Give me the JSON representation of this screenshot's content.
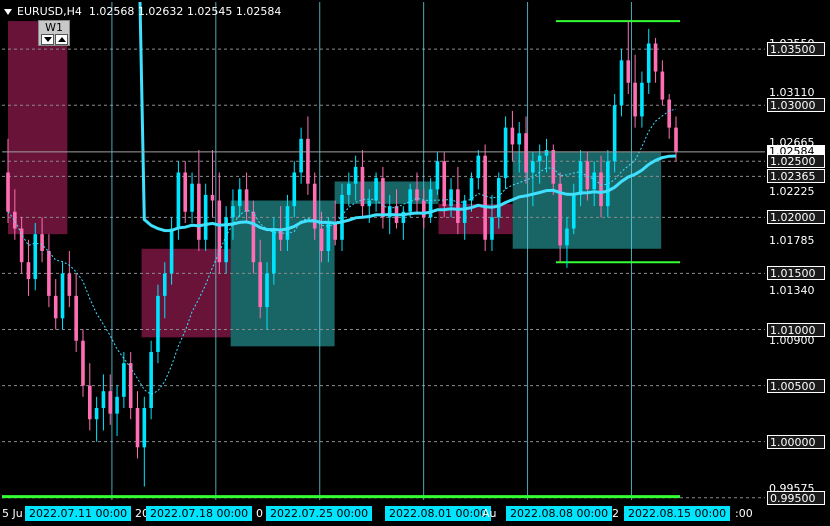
{
  "header": {
    "symbol_info": "EURUSD,H4",
    "ohlc": "1.02568 1.02632 1.02545 1.02584",
    "timeframe_button": "W1"
  },
  "colors": {
    "background": "#000000",
    "grid": "#8c8c8c",
    "bull_candle": "#00e5ff",
    "bear_candle": "#ff6eb4",
    "ma_slow": "#40e0ff",
    "ma_fast_dotted": "#40e0ff",
    "bear_zone": "#8b1a4a",
    "bull_zone": "#2aa7a7",
    "level_line": "#33ff33",
    "vertical_lines": "#5fd3e6"
  },
  "price_axis": {
    "labels": [
      {
        "text": "1.03550",
        "style": "grey",
        "price": 1.0355
      },
      {
        "text": "1.03500",
        "style": "boxed",
        "price": 1.035
      },
      {
        "text": "1.03110",
        "style": "grey",
        "price": 1.0311
      },
      {
        "text": "1.03000",
        "style": "boxed",
        "price": 1.03
      },
      {
        "text": "1.02665",
        "style": "grey",
        "price": 1.02665
      },
      {
        "text": "1.02584",
        "style": "current",
        "price": 1.02584
      },
      {
        "text": "1.02500",
        "style": "boxed",
        "price": 1.025
      },
      {
        "text": "1.02365",
        "style": "boxed",
        "price": 1.02365
      },
      {
        "text": "1.02225",
        "style": "grey",
        "price": 1.02225
      },
      {
        "text": "1.02000",
        "style": "boxed",
        "price": 1.02
      },
      {
        "text": "1.01785",
        "style": "grey",
        "price": 1.01785
      },
      {
        "text": "1.01500",
        "style": "boxed",
        "price": 1.015
      },
      {
        "text": "1.01340",
        "style": "grey",
        "price": 1.0134
      },
      {
        "text": "1.01000",
        "style": "boxed",
        "price": 1.01
      },
      {
        "text": "1.00900",
        "style": "grey",
        "price": 1.009
      },
      {
        "text": "1.00500",
        "style": "boxed",
        "price": 1.005
      },
      {
        "text": "1.00000",
        "style": "boxed",
        "price": 1.0
      },
      {
        "text": "0.99575",
        "style": "grey",
        "price": 0.99575
      },
      {
        "text": "0.99500",
        "style": "boxed",
        "price": 0.995
      }
    ]
  },
  "time_axis": {
    "labels": [
      {
        "text": "5 Ju",
        "style": "plain"
      },
      {
        "text": "2022.07.11 00:00",
        "style": "hl"
      },
      {
        "text": "20",
        "style": "plain"
      },
      {
        "text": "2022.07.18 00:00",
        "style": "hl"
      },
      {
        "text": "0",
        "style": "plain"
      },
      {
        "text": "2022.07.25 00:00",
        "style": "hl"
      },
      {
        "text": "2022.08.01 00:00",
        "style": "hl"
      },
      {
        "text": "Au",
        "style": "plain"
      },
      {
        "text": "2022.08.08 00:00",
        "style": "hl"
      },
      {
        "text": "2",
        "style": "plain"
      },
      {
        "text": "2022.08.15 00:00",
        "style": "hl"
      },
      {
        "text": ":00",
        "style": "plain"
      }
    ]
  },
  "chart_data": {
    "type": "candlestick",
    "symbol": "EURUSD",
    "timeframe": "H4",
    "ylim": [
      0.9948,
      1.0392
    ],
    "current_price": 1.02584,
    "horizontal_levels": [
      1.035,
      1.03,
      1.025,
      1.02365,
      1.02,
      1.015,
      1.01,
      1.005,
      1.0,
      0.995
    ],
    "green_levels": [
      1.0375,
      1.016,
      0.9951
    ],
    "zones": [
      {
        "kind": "bear",
        "from": "2022.07.04",
        "to": "2022.07.08",
        "high": 1.0375,
        "low": 1.0185
      },
      {
        "kind": "bear",
        "from": "2022.07.13",
        "to": "2022.07.19",
        "high": 1.0172,
        "low": 1.0093
      },
      {
        "kind": "bull",
        "from": "2022.07.19",
        "to": "2022.07.26",
        "high": 1.0215,
        "low": 1.0085
      },
      {
        "kind": "bull",
        "from": "2022.07.26",
        "to": "2022.08.02",
        "high": 1.0232,
        "low": 1.0212
      },
      {
        "kind": "bear",
        "from": "2022.08.02",
        "to": "2022.08.07",
        "high": 1.0212,
        "low": 1.0185
      },
      {
        "kind": "bull",
        "from": "2022.08.07",
        "to": "2022.08.17",
        "high": 1.0258,
        "low": 1.0172
      }
    ],
    "ohlc": [
      [
        1.024,
        1.027,
        1.0195,
        1.0205
      ],
      [
        1.0205,
        1.0225,
        1.018,
        1.019
      ],
      [
        1.019,
        1.02,
        1.015,
        1.016
      ],
      [
        1.016,
        1.018,
        1.013,
        1.0145
      ],
      [
        1.0145,
        1.0195,
        1.0135,
        1.0185
      ],
      [
        1.0185,
        1.02,
        1.016,
        1.017
      ],
      [
        1.017,
        1.0185,
        1.012,
        1.013
      ],
      [
        1.013,
        1.0145,
        1.01,
        1.011
      ],
      [
        1.011,
        1.016,
        1.01,
        1.015
      ],
      [
        1.015,
        1.017,
        1.012,
        1.013
      ],
      [
        1.013,
        1.015,
        1.008,
        1.009
      ],
      [
        1.009,
        1.01,
        1.004,
        1.005
      ],
      [
        1.005,
        1.007,
        1.001,
        1.002
      ],
      [
        1.002,
        1.004,
        1.0,
        1.003
      ],
      [
        1.003,
        1.006,
        1.001,
        1.0045
      ],
      [
        1.0045,
        1.006,
        1.0015,
        1.0025
      ],
      [
        1.0025,
        1.005,
        1.0005,
        1.004
      ],
      [
        1.004,
        1.008,
        1.003,
        1.007
      ],
      [
        1.007,
        1.008,
        1.002,
        1.003
      ],
      [
        1.003,
        1.0045,
        0.9985,
        0.9995
      ],
      [
        0.9995,
        1.004,
        0.996,
        1.003
      ],
      [
        1.003,
        1.009,
        1.002,
        1.008
      ],
      [
        1.008,
        1.014,
        1.007,
        1.013
      ],
      [
        1.013,
        1.016,
        1.011,
        1.015
      ],
      [
        1.015,
        1.02,
        1.014,
        1.019
      ],
      [
        1.019,
        1.025,
        1.018,
        1.024
      ],
      [
        1.024,
        1.025,
        1.0195,
        1.0205
      ],
      [
        1.0205,
        1.024,
        1.0195,
        1.023
      ],
      [
        1.023,
        1.026,
        1.017,
        1.018
      ],
      [
        1.018,
        1.023,
        1.017,
        1.022
      ],
      [
        1.022,
        1.026,
        1.02,
        1.0215
      ],
      [
        1.0215,
        1.024,
        1.015,
        1.016
      ],
      [
        1.016,
        1.021,
        1.015,
        1.02
      ],
      [
        1.02,
        1.0225,
        1.018,
        1.021
      ],
      [
        1.021,
        1.0235,
        1.02,
        1.0225
      ],
      [
        1.0225,
        1.024,
        1.0195,
        1.0205
      ],
      [
        1.0205,
        1.0215,
        1.015,
        1.016
      ],
      [
        1.016,
        1.018,
        1.011,
        1.012
      ],
      [
        1.012,
        1.016,
        1.01,
        1.015
      ],
      [
        1.015,
        1.02,
        1.014,
        1.019
      ],
      [
        1.019,
        1.021,
        1.017,
        1.018
      ],
      [
        1.018,
        1.022,
        1.017,
        1.021
      ],
      [
        1.021,
        1.025,
        1.02,
        1.024
      ],
      [
        1.024,
        1.028,
        1.023,
        1.027
      ],
      [
        1.027,
        1.029,
        1.022,
        1.023
      ],
      [
        1.023,
        1.024,
        1.018,
        1.019
      ],
      [
        1.019,
        1.0205,
        1.016,
        1.017
      ],
      [
        1.017,
        1.02,
        1.016,
        1.0195
      ],
      [
        1.0195,
        1.0215,
        1.0175,
        1.018
      ],
      [
        1.018,
        1.023,
        1.017,
        1.022
      ],
      [
        1.022,
        1.024,
        1.021,
        1.023
      ],
      [
        1.023,
        1.0255,
        1.0215,
        1.0245
      ],
      [
        1.0245,
        1.026,
        1.02,
        1.021
      ],
      [
        1.021,
        1.0225,
        1.0195,
        1.0215
      ],
      [
        1.0215,
        1.024,
        1.0205,
        1.0235
      ],
      [
        1.0235,
        1.0245,
        1.019,
        1.02
      ],
      [
        1.02,
        1.022,
        1.0185,
        1.021
      ],
      [
        1.021,
        1.0225,
        1.019,
        1.0195
      ],
      [
        1.0195,
        1.021,
        1.018,
        1.0205
      ],
      [
        1.0205,
        1.023,
        1.02,
        1.0225
      ],
      [
        1.0225,
        1.024,
        1.0205,
        1.0215
      ],
      [
        1.0215,
        1.0225,
        1.019,
        1.02
      ],
      [
        1.02,
        1.0235,
        1.0195,
        1.0225
      ],
      [
        1.0225,
        1.0258,
        1.022,
        1.025
      ],
      [
        1.025,
        1.0258,
        1.02,
        1.021
      ],
      [
        1.021,
        1.0235,
        1.02,
        1.0225
      ],
      [
        1.0225,
        1.0245,
        1.0185,
        1.0195
      ],
      [
        1.0195,
        1.022,
        1.018,
        1.0215
      ],
      [
        1.0215,
        1.024,
        1.0205,
        1.0235
      ],
      [
        1.0235,
        1.026,
        1.0225,
        1.0255
      ],
      [
        1.0255,
        1.0265,
        1.017,
        1.018
      ],
      [
        1.018,
        1.022,
        1.017,
        1.02
      ],
      [
        1.02,
        1.024,
        1.019,
        1.0235
      ],
      [
        1.0235,
        1.029,
        1.0225,
        1.028
      ],
      [
        1.028,
        1.0295,
        1.025,
        1.0265
      ],
      [
        1.0265,
        1.0285,
        1.024,
        1.0275
      ],
      [
        1.0275,
        1.029,
        1.023,
        1.024
      ],
      [
        1.024,
        1.0258,
        1.021,
        1.025
      ],
      [
        1.025,
        1.0265,
        1.023,
        1.0255
      ],
      [
        1.0255,
        1.027,
        1.024,
        1.026
      ],
      [
        1.026,
        1.0265,
        1.022,
        1.023
      ],
      [
        1.023,
        1.024,
        1.016,
        1.0175
      ],
      [
        1.0175,
        1.02,
        1.0155,
        1.019
      ],
      [
        1.019,
        1.023,
        1.0185,
        1.022
      ],
      [
        1.022,
        1.026,
        1.021,
        1.025
      ],
      [
        1.025,
        1.0258,
        1.0215,
        1.0225
      ],
      [
        1.0225,
        1.025,
        1.021,
        1.024
      ],
      [
        1.024,
        1.0255,
        1.02,
        1.021
      ],
      [
        1.021,
        1.026,
        1.02,
        1.025
      ],
      [
        1.025,
        1.031,
        1.024,
        1.03
      ],
      [
        1.03,
        1.035,
        1.029,
        1.034
      ],
      [
        1.034,
        1.0375,
        1.031,
        1.032
      ],
      [
        1.032,
        1.0345,
        1.028,
        1.029
      ],
      [
        1.029,
        1.033,
        1.028,
        1.032
      ],
      [
        1.032,
        1.0368,
        1.031,
        1.0355
      ],
      [
        1.0355,
        1.036,
        1.032,
        1.033
      ],
      [
        1.033,
        1.034,
        1.03,
        1.0305
      ],
      [
        1.0305,
        1.031,
        1.027,
        1.028
      ],
      [
        1.028,
        1.029,
        1.025,
        1.0258
      ]
    ]
  }
}
